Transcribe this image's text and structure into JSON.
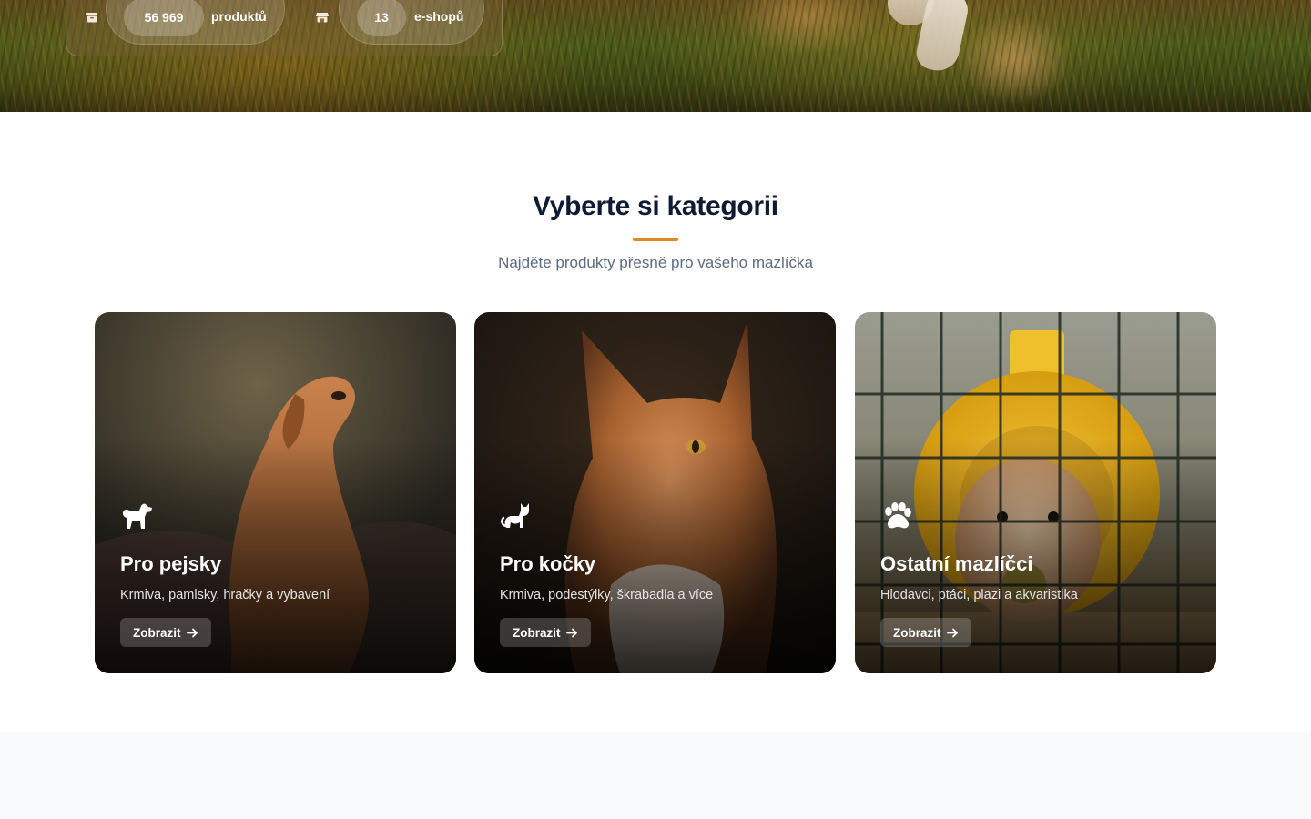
{
  "hero": {
    "stats": [
      {
        "icon": "box-icon",
        "value": "56 969",
        "label": "produktů"
      },
      {
        "icon": "store-icon",
        "value": "13",
        "label": "e-shopů"
      }
    ]
  },
  "categories_section": {
    "title": "Vyberte si kategorii",
    "subtitle": "Najděte produkty přesně pro vašeho mazlíčka",
    "accent_color": "#dd8a22",
    "cards": [
      {
        "icon": "dog-icon",
        "title": "Pro pejsky",
        "description": "Krmiva, pamlsky, hračky a vybavení",
        "button_label": "Zobrazit"
      },
      {
        "icon": "cat-icon",
        "title": "Pro kočky",
        "description": "Krmiva, podestýlky, škrabadla a více",
        "button_label": "Zobrazit"
      },
      {
        "icon": "paw-icon",
        "title": "Ostatní mazlíčci",
        "description": "Hlodavci, ptáci, plazi a akvaristika",
        "button_label": "Zobrazit"
      }
    ]
  }
}
